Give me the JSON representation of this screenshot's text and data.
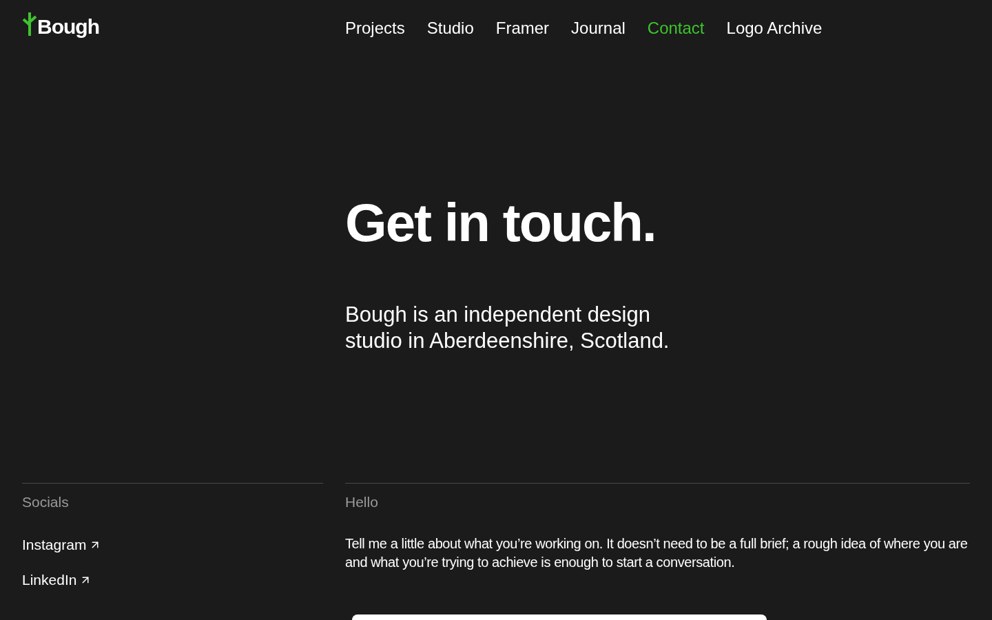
{
  "logo": {
    "text": "Bough"
  },
  "nav": [
    {
      "label": "Projects",
      "selected": false
    },
    {
      "label": "Studio",
      "selected": false
    },
    {
      "label": "Framer",
      "selected": false
    },
    {
      "label": "Journal",
      "selected": false
    },
    {
      "label": "Contact",
      "selected": true
    },
    {
      "label": "Logo Archive",
      "selected": false
    }
  ],
  "hero": {
    "title": "Get in touch.",
    "intro": "Bough is an independent design studio in Aberdeenshire, Scotland."
  },
  "socials": {
    "heading": "Socials",
    "links": [
      "Instagram",
      "LinkedIn"
    ]
  },
  "hello": {
    "heading": "Hello",
    "text": "Tell me a little about what you’re working on. It doesn’t need to be a full brief; a rough idea of where you are and what you’re trying to achieve is enough to start a conversation."
  }
}
